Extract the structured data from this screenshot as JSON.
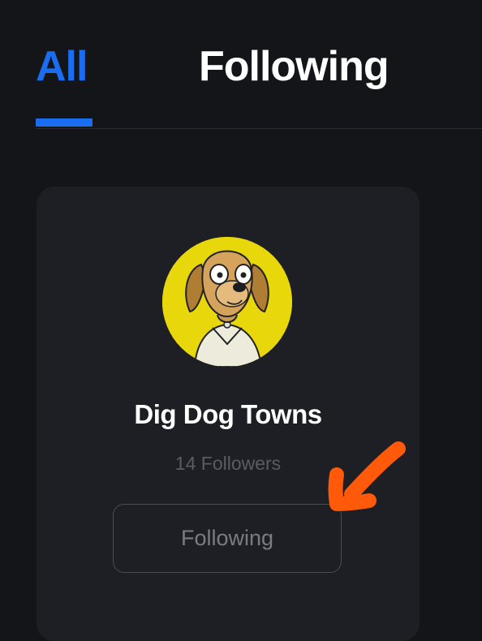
{
  "tabs": {
    "all_label": "All",
    "following_label": "Following",
    "active": "All"
  },
  "card": {
    "name": "Dig Dog Towns",
    "followers_text": "14 Followers",
    "follow_button_label": "Following"
  },
  "icons": {
    "avatar": "dog-avatar-icon",
    "annotation": "orange-arrow-icon"
  },
  "colors": {
    "background": "#141519",
    "card": "#1e1f25",
    "accent": "#1a6cf0",
    "avatar_bg": "#e8d70b",
    "annotation": "#ff5a0a"
  }
}
